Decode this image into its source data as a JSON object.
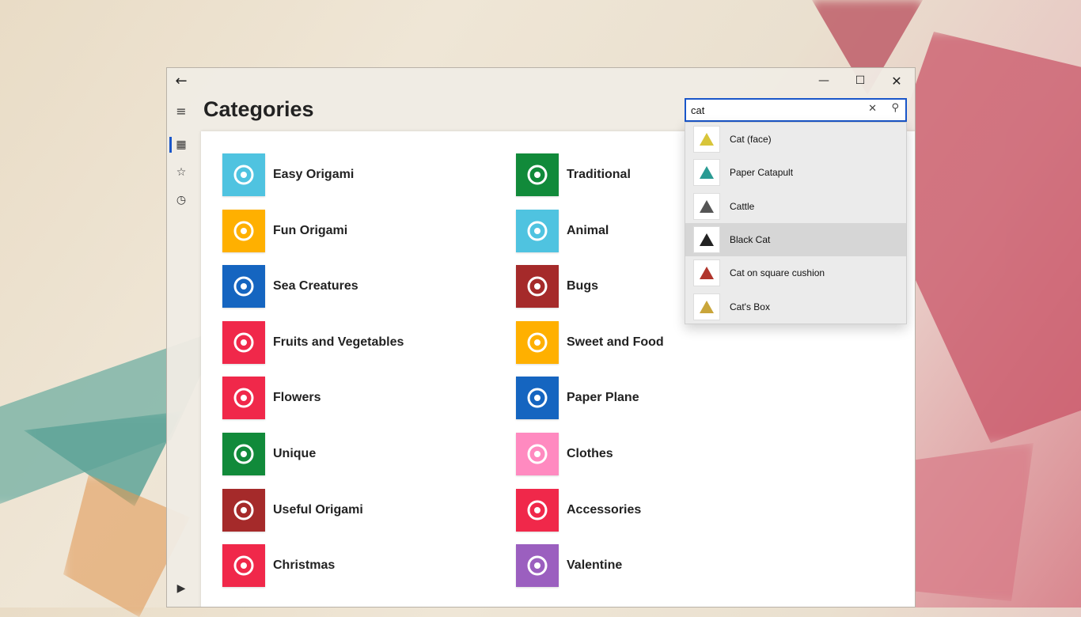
{
  "window": {
    "back_glyph": "←",
    "min_glyph": "—",
    "max_glyph": "☐",
    "close_glyph": "✕"
  },
  "rail": {
    "menu_glyph": "≡",
    "grid_glyph": "▦",
    "star_glyph": "☆",
    "history_glyph": "◷",
    "store_glyph": "▶",
    "info_glyph": "ⓘ"
  },
  "page": {
    "title": "Categories"
  },
  "search": {
    "value": "cat",
    "clear_glyph": "✕",
    "go_glyph": "⚲",
    "suggestions": [
      {
        "label": "Cat (face)",
        "icon": "cat-face-icon",
        "color": "#d8c53a"
      },
      {
        "label": "Paper Catapult",
        "icon": "catapult-icon",
        "color": "#2a9b93"
      },
      {
        "label": "Cattle",
        "icon": "cattle-icon",
        "color": "#555555"
      },
      {
        "label": "Black Cat",
        "icon": "black-cat-icon",
        "color": "#222222"
      },
      {
        "label": "Cat on square cushion",
        "icon": "cushion-cat-icon",
        "color": "#b0352c"
      },
      {
        "label": "Cat's Box",
        "icon": "cat-box-icon",
        "color": "#c9a53a"
      }
    ],
    "highlighted_index": 3
  },
  "categories": {
    "left": [
      {
        "label": "Easy Origami",
        "color": "#4fc3e0",
        "icon": "house-icon"
      },
      {
        "label": "Fun Origami",
        "color": "#ffb000",
        "icon": "pinwheel-icon"
      },
      {
        "label": "Sea Creatures",
        "color": "#1565c0",
        "icon": "fish-icon"
      },
      {
        "label": "Fruits and Vegetables",
        "color": "#f0284a",
        "icon": "strawberry-icon"
      },
      {
        "label": "Flowers",
        "color": "#f0284a",
        "icon": "flower-icon"
      },
      {
        "label": "Unique",
        "color": "#118a3a",
        "icon": "turtle-icon"
      },
      {
        "label": "Useful Origami",
        "color": "#a52a2a",
        "icon": "wallet-icon"
      },
      {
        "label": "Christmas",
        "color": "#f0284a",
        "icon": "tree-icon"
      }
    ],
    "right": [
      {
        "label": "Traditional",
        "color": "#118a3a",
        "icon": "crane-icon"
      },
      {
        "label": "Animal",
        "color": "#4fc3e0",
        "icon": "giraffe-icon"
      },
      {
        "label": "Bugs",
        "color": "#a52a2a",
        "icon": "ladybug-icon"
      },
      {
        "label": "Sweet and Food",
        "color": "#ffb000",
        "icon": "icecream-icon"
      },
      {
        "label": "Paper Plane",
        "color": "#1565c0",
        "icon": "plane-icon"
      },
      {
        "label": "Clothes",
        "color": "#ff8ac0",
        "icon": "shirt-icon"
      },
      {
        "label": "Accessories",
        "color": "#f0284a",
        "icon": "necklace-icon"
      },
      {
        "label": "Valentine",
        "color": "#9b5fbf",
        "icon": "heart-icon"
      }
    ]
  }
}
